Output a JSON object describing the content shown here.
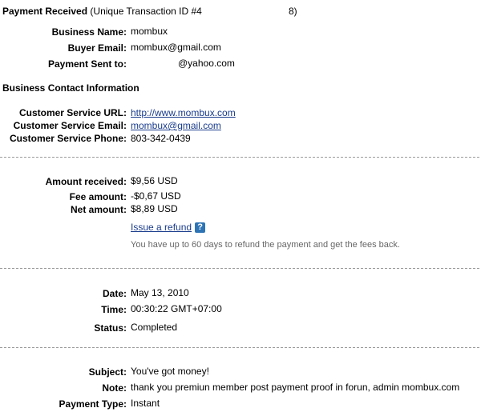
{
  "header": {
    "title": "Payment Received",
    "transaction": "(Unique Transaction ID #4",
    "transaction_suffix": "8)"
  },
  "details": {
    "business_name_label": "Business Name:",
    "business_name": "mombux",
    "buyer_email_label": "Buyer Email:",
    "buyer_email": "mombux@gmail.com",
    "payment_sent_label": "Payment Sent to:",
    "payment_sent": "@yahoo.com"
  },
  "contact": {
    "heading": "Business Contact Information",
    "url_label": "Customer Service URL:",
    "url": "http://www.mombux.com",
    "email_label": "Customer Service Email:",
    "email": "mombux@gmail.com",
    "phone_label": "Customer Service Phone:",
    "phone": "803-342-0439"
  },
  "amounts": {
    "received_label": "Amount received:",
    "received": "$9,56 USD",
    "fee_label": "Fee amount:",
    "fee": "-$0,67 USD",
    "net_label": "Net amount:",
    "net": "$8,89 USD",
    "refund_link": "Issue a refund",
    "help_glyph": "?",
    "refund_hint": "You have up to 60 days to refund the payment and get the fees back."
  },
  "status": {
    "date_label": "Date:",
    "date": "May 13, 2010",
    "time_label": "Time:",
    "time": "00:30:22 GMT+07:00",
    "status_label": "Status:",
    "status": "Completed"
  },
  "message": {
    "subject_label": "Subject:",
    "subject": "You've got money!",
    "note_label": "Note:",
    "note": "thank you premiun member post payment proof in forun, admin mombux.com",
    "type_label": "Payment Type:",
    "type": "Instant"
  },
  "colors": {
    "link": "#1a3c8c",
    "divider": "#9a9a9a",
    "hint": "#666666",
    "help_icon": "#2e74b5"
  }
}
